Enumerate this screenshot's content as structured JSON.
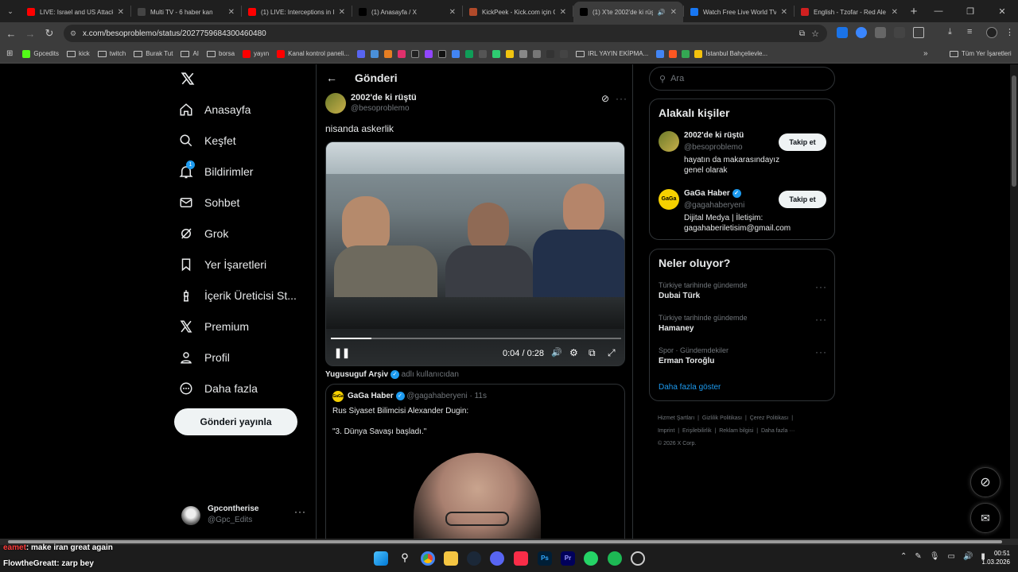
{
  "browser": {
    "tabs": [
      {
        "title": "LIVE: Israel and US Attack",
        "favicon_color": "#ff0000"
      },
      {
        "title": "Multi TV - 6 haber kan",
        "favicon_color": "#444444"
      },
      {
        "title": "(1) LIVE: Interceptions in I",
        "favicon_color": "#ff0000"
      },
      {
        "title": "(1) Anasayfa / X",
        "favicon_color": "#000000"
      },
      {
        "title": "KickPeek - Kick.com için G",
        "favicon_color": "#b04a2a"
      },
      {
        "title": "(1) X'te 2002'de ki rüşt",
        "favicon_color": "#000000"
      },
      {
        "title": "Watch Free Live World TV",
        "favicon_color": "#1877f2"
      },
      {
        "title": "English - Tzofar - Red Ale",
        "favicon_color": "#d02020"
      }
    ],
    "url": "x.com/besoproblemo/status/2027759684300460480",
    "bookmarks": [
      "Gpcedits",
      "kick",
      "twitch",
      "Burak Tut",
      "AI",
      "borsa",
      "yayın",
      "Kanal kontrol paneli...",
      "IRL YAYIN EKİPMA...",
      "İstanbul Bahçelievle..."
    ],
    "all_bookmarks": "Tüm Yer İşaretleri"
  },
  "nav": {
    "items": [
      "Anasayfa",
      "Keşfet",
      "Bildirimler",
      "Sohbet",
      "Grok",
      "Yer İşaretleri",
      "İçerik Üreticisi St...",
      "Premium",
      "Profil",
      "Daha fazla"
    ],
    "notification_count": "1",
    "post_button": "Gönderi yayınla",
    "account_name": "Gpcontherise",
    "account_handle": "@Gpc_Edits"
  },
  "main": {
    "header_title": "Gönderi",
    "author_name": "2002'de ki rüştü",
    "author_handle": "@besoproblemo",
    "post_text": "nisanda askerlik",
    "video_time": "0:04 / 0:28",
    "video_progress": 0.14,
    "attribution_name": "Yugusuguf Arşiv",
    "attribution_suffix": "adlı kullanıcıdan",
    "quote_name": "GaGa Haber",
    "quote_handle": "@gagahaberyeni",
    "quote_time": "· 11s",
    "quote_line1": "Rus Siyaset Bilimcisi Alexander Dugin:",
    "quote_line2": "\"3. Dünya Savaşı başladı.\""
  },
  "search": {
    "placeholder": "Ara"
  },
  "related": {
    "title": "Alakalı kişiler",
    "people": [
      {
        "name": "2002'de ki rüştü",
        "handle": "@besoproblemo",
        "bio": "hayatın da makarasındayız genel olarak",
        "button": "Takip et"
      },
      {
        "name": "GaGa Haber",
        "handle": "@gagahaberyeni",
        "bio": "Dijital Medya | İletişim: gagahaberiletisim@gmail.com",
        "button": "Takip et"
      }
    ]
  },
  "trends": {
    "title": "Neler oluyor?",
    "items": [
      {
        "context": "Türkiye tarihinde gündemde",
        "name": "Dubai Türk"
      },
      {
        "context": "Türkiye tarihinde gündemde",
        "name": "Hamaney"
      },
      {
        "context": "Spor · Gündemdekiler",
        "name": "Erman Toroğlu"
      }
    ],
    "show_more": "Daha fazla göster"
  },
  "footer": {
    "links": [
      "Hizmet Şartları",
      "Gizlilik Politikası",
      "Çerez Politikası",
      "Imprint",
      "Erişilebilirlik",
      "Reklam bilgisi",
      "Daha fazla ···"
    ],
    "copyright": "© 2026 X Corp."
  },
  "chat_overlay": [
    {
      "user": "eamet",
      "msg": ": make iran great again",
      "color": "#ff3b3b"
    },
    {
      "user": "FlowtheGreatt",
      "msg": ": zarp bey",
      "color": "#ffffff"
    }
  ],
  "taskbar": {
    "time": "00:51",
    "date": "1.03.2026"
  }
}
